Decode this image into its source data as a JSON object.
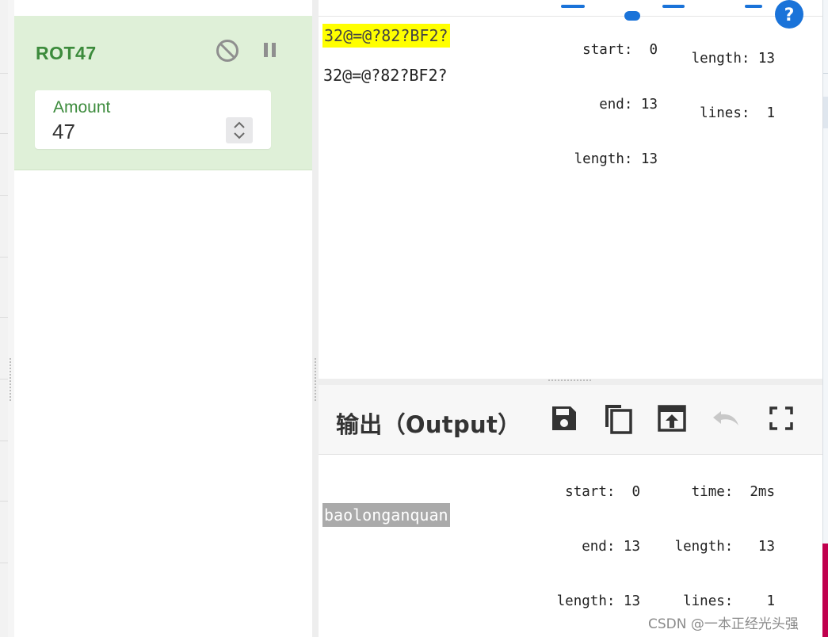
{
  "recipe": {
    "operation": {
      "title": "ROT47",
      "disable_icon": "disable-icon",
      "pause_icon": "pause-icon",
      "amount_label": "Amount",
      "amount_value": "47"
    }
  },
  "input": {
    "highlighted_text": "32@=@?82?BF2?",
    "text": "32@=@?82?BF2?",
    "selection_stats": {
      "start": "start:  0",
      "end": "end: 13",
      "length": "length: 13"
    },
    "stats": {
      "length": "length: 13",
      "lines": "lines:  1"
    }
  },
  "output": {
    "title": "输出（Output）",
    "toolbar": {
      "save_icon": "save-icon",
      "copy_icon": "copy-icon",
      "replace_input_icon": "move-to-input-icon",
      "undo_icon": "undo-icon",
      "maximise_icon": "fullscreen-icon"
    },
    "selection_stats": {
      "start": "start:  0",
      "end": "end: 13",
      "length": "length: 13"
    },
    "stats": {
      "time": "time:  2ms",
      "length": "length:   13",
      "lines": "lines:    1"
    },
    "text": "baolonganquan"
  },
  "watermark": "CSDN @一本正经光头强",
  "colors": {
    "op_card_bg": "#dff0d8",
    "op_green": "#3c8b3c",
    "highlight_yellow": "#ffff00",
    "selection_grey": "#aaaaaa",
    "help_blue": "#1a73d9"
  }
}
